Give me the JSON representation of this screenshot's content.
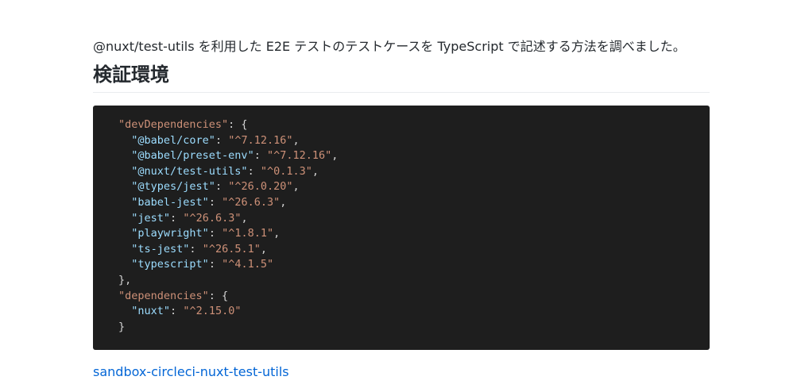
{
  "intro": "@nuxt/test-utils を利用した E2E テストのテストケースを TypeScript で記述する方法を調べました。",
  "heading": "検証環境",
  "code": {
    "dev_key": "\"devDependencies\"",
    "dev_entries": [
      {
        "key": "\"@babel/core\"",
        "value": "\"^7.12.16\"",
        "comma": ","
      },
      {
        "key": "\"@babel/preset-env\"",
        "value": "\"^7.12.16\"",
        "comma": ","
      },
      {
        "key": "\"@nuxt/test-utils\"",
        "value": "\"^0.1.3\"",
        "comma": ","
      },
      {
        "key": "\"@types/jest\"",
        "value": "\"^26.0.20\"",
        "comma": ","
      },
      {
        "key": "\"babel-jest\"",
        "value": "\"^26.6.3\"",
        "comma": ","
      },
      {
        "key": "\"jest\"",
        "value": "\"^26.6.3\"",
        "comma": ","
      },
      {
        "key": "\"playwright\"",
        "value": "\"^1.8.1\"",
        "comma": ","
      },
      {
        "key": "\"ts-jest\"",
        "value": "\"^26.5.1\"",
        "comma": ","
      },
      {
        "key": "\"typescript\"",
        "value": "\"^4.1.5\"",
        "comma": ""
      }
    ],
    "dev_close": "},",
    "dep_key": "\"dependencies\"",
    "dep_entries": [
      {
        "key": "\"nuxt\"",
        "value": "\"^2.15.0\"",
        "comma": ""
      }
    ],
    "dep_close": "}",
    "colon_open": ": {",
    "colon": ": "
  },
  "link": "sandbox-circleci-nuxt-test-utils",
  "colors": {
    "code_background": "#1e1e1e",
    "key": "#9cdcfe",
    "string": "#ce9178",
    "link": "#0366d6"
  }
}
